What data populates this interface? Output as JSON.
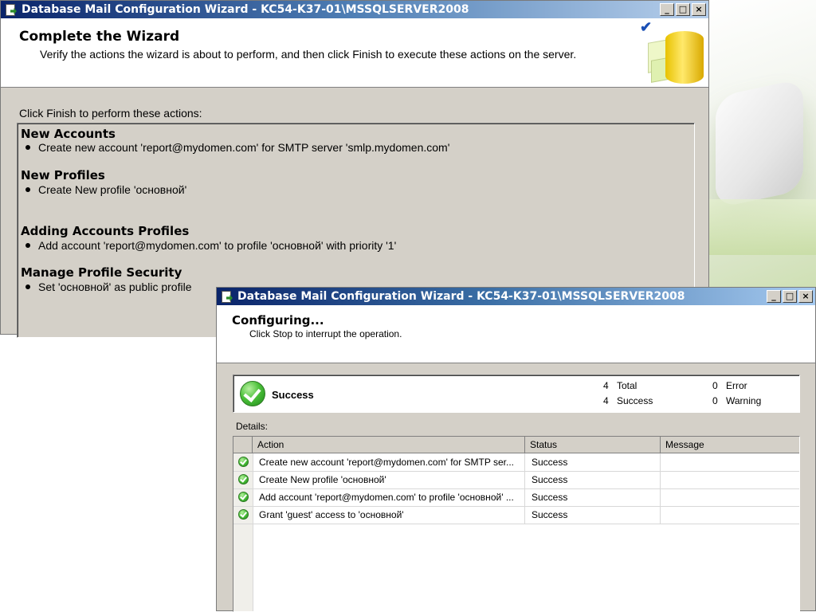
{
  "window1": {
    "title": "Database Mail Configuration Wizard - KC54-K37-01\\MSSQLSERVER2008",
    "header_title": "Complete the Wizard",
    "header_subtitle": "Verify the actions the wizard is about to perform, and then click Finish to execute these actions on the server.",
    "lead": "Click Finish to perform these actions:",
    "sections": [
      {
        "title": "New Accounts",
        "items": [
          "Create new account 'report@mydomen.com' for SMTP server 'smlp.mydomen.com'"
        ]
      },
      {
        "title": "New Profiles",
        "items": [
          "Create New profile 'основной'"
        ]
      },
      {
        "title": "Adding Accounts Profiles",
        "items": [
          "Add account 'report@mydomen.com' to profile 'основной' with priority '1'"
        ]
      },
      {
        "title": "Manage Profile Security",
        "items": [
          "Set 'основной' as public profile"
        ]
      }
    ]
  },
  "window2": {
    "title": "Database Mail Configuration Wizard - KC54-K37-01\\MSSQLSERVER2008",
    "header_title": "Configuring...",
    "header_subtitle": "Click Stop to interrupt the operation.",
    "status": "Success",
    "counts": {
      "total_num": "4",
      "total_label": "Total",
      "success_num": "4",
      "success_label": "Success",
      "error_num": "0",
      "error_label": "Error",
      "warning_num": "0",
      "warning_label": "Warning"
    },
    "details_label": "Details:",
    "columns": [
      "Action",
      "Status",
      "Message"
    ],
    "rows": [
      {
        "action": "Create new account 'report@mydomen.com' for SMTP ser...",
        "status": "Success",
        "message": ""
      },
      {
        "action": "Create New profile 'основной'",
        "status": "Success",
        "message": ""
      },
      {
        "action": "Add account 'report@mydomen.com' to profile 'основной' ...",
        "status": "Success",
        "message": ""
      },
      {
        "action": "Grant 'guest' access to 'основной'",
        "status": "Success",
        "message": ""
      }
    ]
  },
  "icons": {
    "minimize": "_",
    "maximize": "□",
    "close": "×",
    "checkmark": "✔"
  },
  "colors": {
    "titlebar_start": "#0a246a",
    "titlebar_end": "#a6caf0",
    "window_bg": "#d4d0c8",
    "success_green": "#4cc13a"
  }
}
